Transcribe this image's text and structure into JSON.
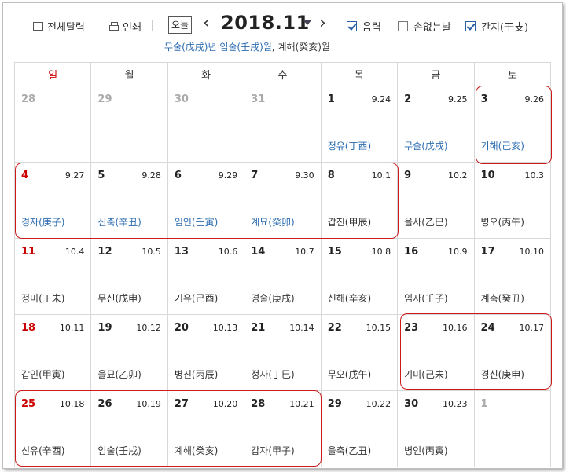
{
  "toolbar": {
    "full_calendar_label": "전체달력",
    "print_label": "인쇄",
    "today_label": "오늘",
    "month_label": "2018.11",
    "options": [
      {
        "label": "음력",
        "checked": true
      },
      {
        "label": "손없는날",
        "checked": false
      },
      {
        "label": "간지(干支)",
        "checked": true
      }
    ]
  },
  "subtitle": {
    "year": "무술(戊戌)년",
    "month": "임술(壬戌)월",
    "day": "계해(癸亥)월"
  },
  "weekdays": [
    "일",
    "월",
    "화",
    "수",
    "목",
    "금",
    "토"
  ],
  "weeks": [
    [
      {
        "day": "28",
        "lunar": "",
        "ganji": "",
        "other": true
      },
      {
        "day": "29",
        "lunar": "",
        "ganji": "",
        "other": true
      },
      {
        "day": "30",
        "lunar": "",
        "ganji": "",
        "other": true
      },
      {
        "day": "31",
        "lunar": "",
        "ganji": "",
        "other": true
      },
      {
        "day": "1",
        "lunar": "9.24",
        "ganji": "정유(丁酉)",
        "blue": true
      },
      {
        "day": "2",
        "lunar": "9.25",
        "ganji": "무술(戊戌)",
        "blue": true
      },
      {
        "day": "3",
        "lunar": "9.26",
        "ganji": "기해(己亥)",
        "blue": true
      }
    ],
    [
      {
        "day": "4",
        "lunar": "9.27",
        "ganji": "경자(庚子)",
        "blue": true
      },
      {
        "day": "5",
        "lunar": "9.28",
        "ganji": "신축(辛丑)",
        "blue": true
      },
      {
        "day": "6",
        "lunar": "9.29",
        "ganji": "임인(壬寅)",
        "blue": true
      },
      {
        "day": "7",
        "lunar": "9.30",
        "ganji": "계묘(癸卯)",
        "blue": true
      },
      {
        "day": "8",
        "lunar": "10.1",
        "ganji": "갑진(甲辰)"
      },
      {
        "day": "9",
        "lunar": "10.2",
        "ganji": "을사(乙巳)"
      },
      {
        "day": "10",
        "lunar": "10.3",
        "ganji": "병오(丙午)"
      }
    ],
    [
      {
        "day": "11",
        "lunar": "10.4",
        "ganji": "정미(丁未)"
      },
      {
        "day": "12",
        "lunar": "10.5",
        "ganji": "무신(戊申)"
      },
      {
        "day": "13",
        "lunar": "10.6",
        "ganji": "기유(己酉)"
      },
      {
        "day": "14",
        "lunar": "10.7",
        "ganji": "경술(庚戌)"
      },
      {
        "day": "15",
        "lunar": "10.8",
        "ganji": "신해(辛亥)"
      },
      {
        "day": "16",
        "lunar": "10.9",
        "ganji": "임자(壬子)"
      },
      {
        "day": "17",
        "lunar": "10.10",
        "ganji": "계축(癸丑)"
      }
    ],
    [
      {
        "day": "18",
        "lunar": "10.11",
        "ganji": "갑인(甲寅)"
      },
      {
        "day": "19",
        "lunar": "10.12",
        "ganji": "을묘(乙卯)"
      },
      {
        "day": "20",
        "lunar": "10.13",
        "ganji": "병진(丙辰)"
      },
      {
        "day": "21",
        "lunar": "10.14",
        "ganji": "정사(丁巳)"
      },
      {
        "day": "22",
        "lunar": "10.15",
        "ganji": "무오(戊午)"
      },
      {
        "day": "23",
        "lunar": "10.16",
        "ganji": "기미(己未)"
      },
      {
        "day": "24",
        "lunar": "10.17",
        "ganji": "경신(庚申)"
      }
    ],
    [
      {
        "day": "25",
        "lunar": "10.18",
        "ganji": "신유(辛酉)"
      },
      {
        "day": "26",
        "lunar": "10.19",
        "ganji": "임술(壬戌)"
      },
      {
        "day": "27",
        "lunar": "10.20",
        "ganji": "계해(癸亥)"
      },
      {
        "day": "28",
        "lunar": "10.21",
        "ganji": "갑자(甲子)"
      },
      {
        "day": "29",
        "lunar": "10.22",
        "ganji": "을축(乙丑)"
      },
      {
        "day": "30",
        "lunar": "10.23",
        "ganji": "병인(丙寅)"
      },
      {
        "day": "1",
        "lunar": "",
        "ganji": "",
        "other": true
      }
    ]
  ],
  "colors": {
    "sunday": "#cc0000",
    "ganji_blue": "#2b6cb0",
    "highlight": "#cc1a1a"
  }
}
